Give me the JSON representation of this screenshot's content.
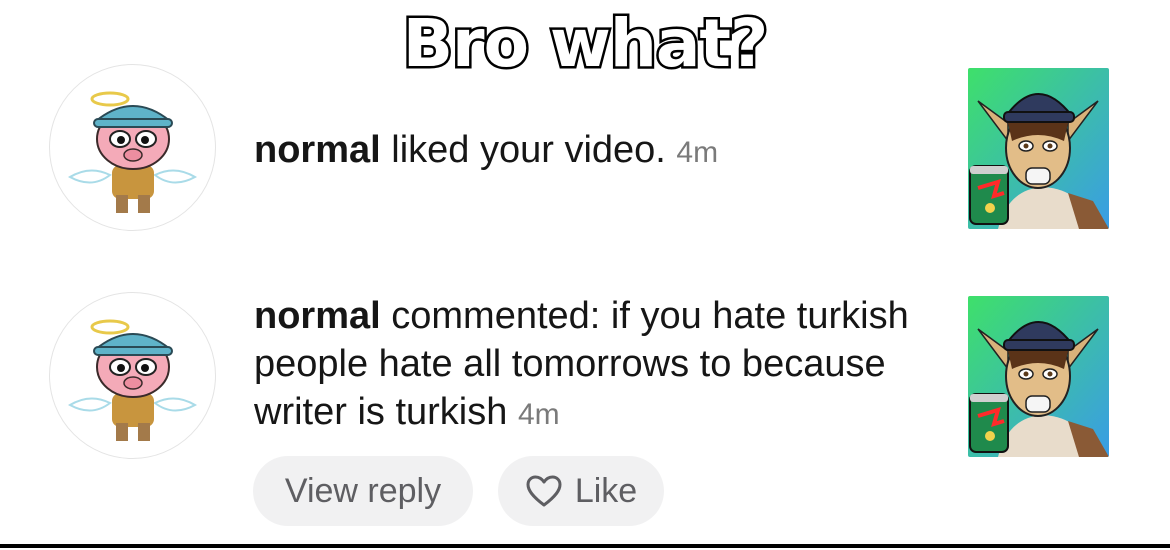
{
  "meme": {
    "caption": "Bro what?"
  },
  "notifications": [
    {
      "username": "normal",
      "action": " liked your video.",
      "time": "4m"
    },
    {
      "username": "normal",
      "action": " commented: if you hate turkish people hate all tomorrows to because writer is turkish",
      "time": "4m"
    }
  ],
  "actions": {
    "view_reply_label": "View reply",
    "like_label": "Like"
  },
  "icons": {
    "avatar": "angel-pig-cartoon-avatar",
    "thumbnail": "cartoon-character-with-soda-can-thumbnail",
    "like": "heart-outline-icon"
  },
  "colors": {
    "text": "#161616",
    "timestamp": "#7a7a7a",
    "pill_bg": "#f1f1f2",
    "pill_text": "#5e5e62",
    "thumbnail_bg": "#4fe07a"
  }
}
